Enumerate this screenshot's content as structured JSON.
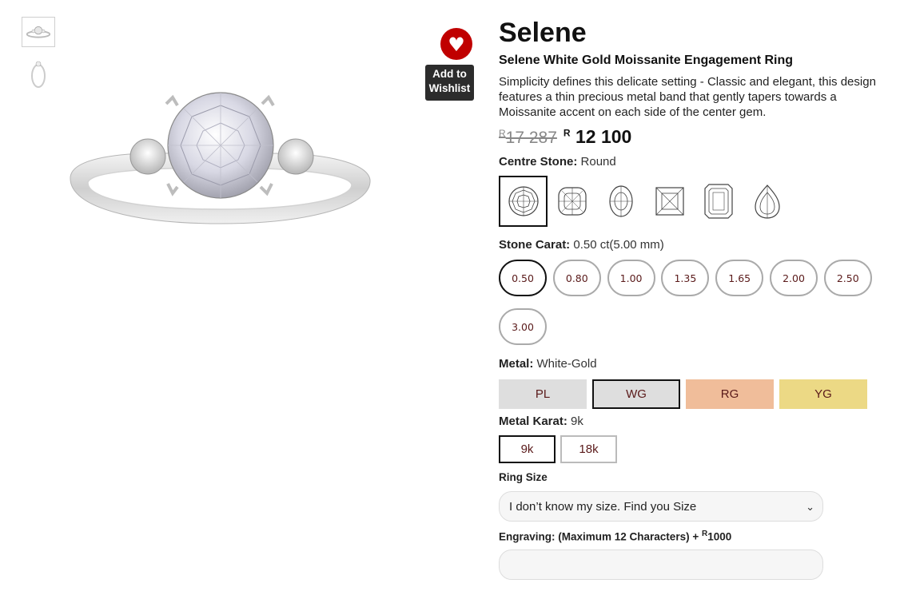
{
  "product": {
    "title": "Selene",
    "subtitle": "Selene White Gold Moissanite Engagement Ring",
    "description": "Simplicity defines this delicate setting - Classic and elegant, this design features a thin precious metal band that gently tapers towards a Moissanite accent on each side of the center gem.",
    "currency_symbol": "R",
    "old_price": "17 287",
    "new_price": "12 100"
  },
  "wishlist": {
    "icon": "heart-icon",
    "label": "Add to Wishlist",
    "color": "#c00000"
  },
  "thumbnails": [
    {
      "name": "ring-front-view"
    },
    {
      "name": "ring-side-view"
    }
  ],
  "centre_stone": {
    "label": "Centre Stone:",
    "value": "Round",
    "shapes": [
      "round",
      "cushion",
      "oval",
      "princess",
      "emerald",
      "pear"
    ],
    "selected": "round"
  },
  "stone_carat": {
    "label": "Stone Carat:",
    "value": "0.50 ct(5.00 mm)",
    "options": [
      "0.50",
      "0.80",
      "1.00",
      "1.35",
      "1.65",
      "2.00",
      "2.50",
      "3.00"
    ],
    "selected": "0.50"
  },
  "metal": {
    "label": "Metal:",
    "value": "White-Gold",
    "options": [
      {
        "code": "PL",
        "color": "#dedede"
      },
      {
        "code": "WG",
        "color": "#dedede"
      },
      {
        "code": "RG",
        "color": "#f0bd9a"
      },
      {
        "code": "YG",
        "color": "#ecd985"
      }
    ],
    "selected": "WG"
  },
  "metal_karat": {
    "label": "Metal Karat:",
    "value": "9k",
    "options": [
      "9k",
      "18k"
    ],
    "selected": "9k"
  },
  "ring_size": {
    "label": "Ring Size",
    "selected_option": "I don’t know my size. Find you Size"
  },
  "engraving": {
    "label": "Engraving: (Maximum 12 Characters) +",
    "price_symbol": "R",
    "price": "1000",
    "value": ""
  }
}
